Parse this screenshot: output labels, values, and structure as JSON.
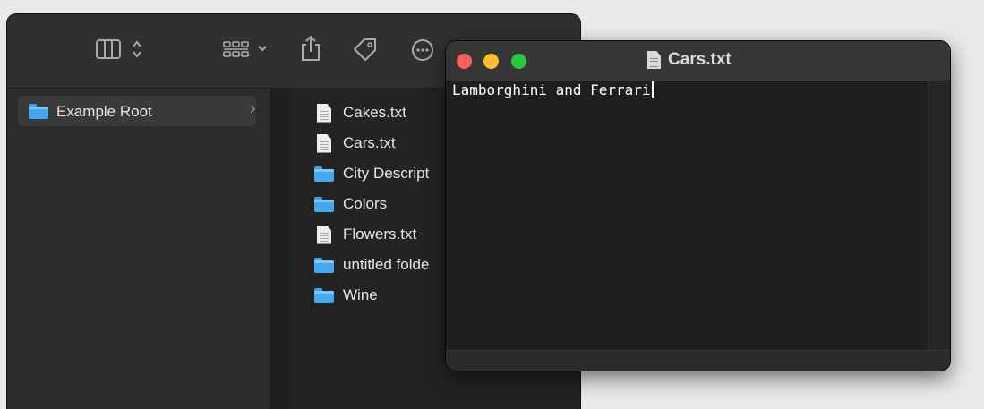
{
  "finder": {
    "toolbar": {
      "icons": [
        "columns-view-icon",
        "sort-chevrons-icon",
        "group-by-icon",
        "share-icon",
        "tag-icon",
        "more-actions-icon"
      ]
    },
    "sidebar": {
      "selected_item": {
        "label": "Example Root",
        "icon": "folder-icon"
      }
    },
    "files": [
      {
        "name": "Cakes.txt",
        "type": "document"
      },
      {
        "name": "Cars.txt",
        "type": "document"
      },
      {
        "name": "City Descript",
        "type": "folder"
      },
      {
        "name": "Colors",
        "type": "folder"
      },
      {
        "name": "Flowers.txt",
        "type": "document"
      },
      {
        "name": "untitled folde",
        "type": "folder"
      },
      {
        "name": "Wine",
        "type": "folder"
      }
    ]
  },
  "editor": {
    "title": "Cars.txt",
    "content": "Lamborghini and Ferrari",
    "traffic_lights": {
      "close": "#fe5f57",
      "minimize": "#febc2e",
      "zoom": "#28c840"
    }
  },
  "colors": {
    "folder": "#42a8f0",
    "window_bg": "#262626"
  }
}
